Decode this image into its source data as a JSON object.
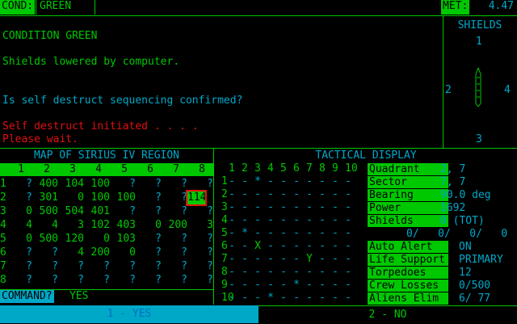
{
  "status": {
    "cond_label": "COND:",
    "cond_value": "GREEN",
    "met_label": "MET:",
    "met_value": "4.47"
  },
  "messages": [
    {
      "text": "CONDITION GREEN",
      "color": "#00c800"
    },
    {
      "text": "Shields lowered by computer.",
      "color": "#00c800"
    },
    {
      "text": "Is self destruct sequencing confirmed?",
      "color": "#00a8c8"
    },
    {
      "text": "Self destruct initiated . . . .",
      "color": "#e01010"
    },
    {
      "text": "Please wait.",
      "color": "#e01010"
    }
  ],
  "shields": {
    "title": "SHIELDS",
    "n1": "1",
    "n2": "2",
    "n3": "3",
    "n4": "4"
  },
  "map": {
    "title": "MAP OF SIRIUS IV REGION",
    "columns": [
      "1",
      "2",
      "3",
      "4",
      "5",
      "6",
      "7",
      "8"
    ],
    "rows": [
      {
        "label": "1",
        "cells": [
          "?",
          "400",
          "104",
          "100",
          "?",
          "?",
          "?",
          "?"
        ]
      },
      {
        "label": "2",
        "cells": [
          "?",
          "301",
          "0",
          "100",
          "100",
          "?",
          "?",
          "114"
        ]
      },
      {
        "label": "3",
        "cells": [
          "0",
          "500",
          "504",
          "401",
          "?",
          "?",
          "?",
          "?"
        ]
      },
      {
        "label": "4",
        "cells": [
          "4",
          "4",
          "3",
          "102",
          "403",
          "0",
          "200",
          "3"
        ]
      },
      {
        "label": "5",
        "cells": [
          "0",
          "500",
          "120",
          "0",
          "103",
          "?",
          "?",
          "?"
        ]
      },
      {
        "label": "6",
        "cells": [
          "?",
          "?",
          "4",
          "200",
          "0",
          "?",
          "?",
          "?"
        ]
      },
      {
        "label": "7",
        "cells": [
          "?",
          "?",
          "?",
          "?",
          "?",
          "?",
          "?",
          "?"
        ]
      },
      {
        "label": "8",
        "cells": [
          "?",
          "?",
          "?",
          "?",
          "?",
          "?",
          "?",
          "?"
        ]
      }
    ]
  },
  "tactical": {
    "title": "TACTICAL DISPLAY",
    "columns": [
      "1",
      "2",
      "3",
      "4",
      "5",
      "6",
      "7",
      "8",
      "9",
      "10"
    ],
    "rows": [
      "1",
      "2",
      "3",
      "4",
      "5",
      "6",
      "7",
      "8",
      "9",
      "10"
    ],
    "objects": [
      {
        "row": 1,
        "col": 3,
        "glyph": "*"
      },
      {
        "row": 5,
        "col": 2,
        "glyph": "*"
      },
      {
        "row": 6,
        "col": 3,
        "glyph": "X"
      },
      {
        "row": 7,
        "col": 7,
        "glyph": "Y"
      },
      {
        "row": 9,
        "col": 6,
        "glyph": "*"
      },
      {
        "row": 10,
        "col": 4,
        "glyph": "*"
      }
    ]
  },
  "info": [
    {
      "label": "Quadrant",
      "value": "2, 7"
    },
    {
      "label": "Sector",
      "value": "7, 7"
    },
    {
      "label": "Bearing",
      "value": "90.0 deg"
    },
    {
      "label": "Power",
      "value": "1692"
    },
    {
      "label": "Shields",
      "value": "0 (TOT)"
    }
  ],
  "shield_levels": "0/   0/   0/   0",
  "status_info": [
    {
      "label": "Auto Alert",
      "value": "ON"
    },
    {
      "label": "Life Support",
      "value": "PRIMARY"
    },
    {
      "label": "Torpedoes",
      "value": "12"
    },
    {
      "label": "Crew Losses",
      "value": "0/500"
    },
    {
      "label": "Aliens Elim",
      "value": "6/ 77"
    }
  ],
  "command": {
    "prompt": "COMMAND?",
    "answer": "YES"
  },
  "choices": {
    "yes": "1 - YES",
    "no": "2 - NO"
  }
}
